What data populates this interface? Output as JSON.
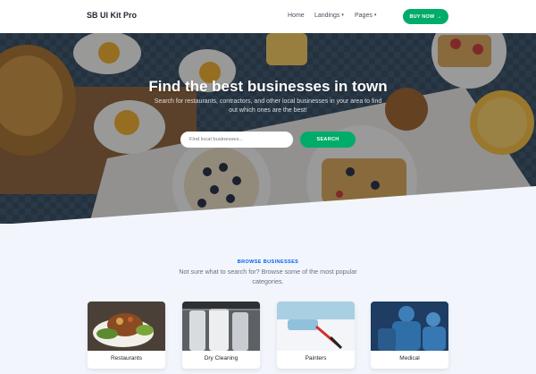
{
  "navbar": {
    "brand": "SB UI Kit Pro",
    "links": [
      {
        "label": "Home"
      },
      {
        "label": "Landings",
        "caret": "▾"
      },
      {
        "label": "Pages",
        "caret": "▾"
      }
    ],
    "cta_label": "BUY NOW",
    "cta_icon": "arrow-right-icon"
  },
  "hero": {
    "title": "Find the best businesses in town",
    "subtitle": "Search for restaurants, contractors, and other local businesses in your area to find out which ones are the best!",
    "search_placeholder": "Find local businesses...",
    "search_button": "SEARCH"
  },
  "browse": {
    "eyebrow": "BROWSE BUSINESSES",
    "text": "Not sure what to search for? Browse some of the most popular categories."
  },
  "categories": [
    {
      "label": "Restaurants"
    },
    {
      "label": "Dry Cleaning"
    },
    {
      "label": "Painters"
    },
    {
      "label": "Medical"
    }
  ],
  "colors": {
    "primary": "#0061f2",
    "success": "#00ac69",
    "text_dark": "#212832",
    "text_muted": "#69707a",
    "page_bg": "#f2f6fc"
  }
}
